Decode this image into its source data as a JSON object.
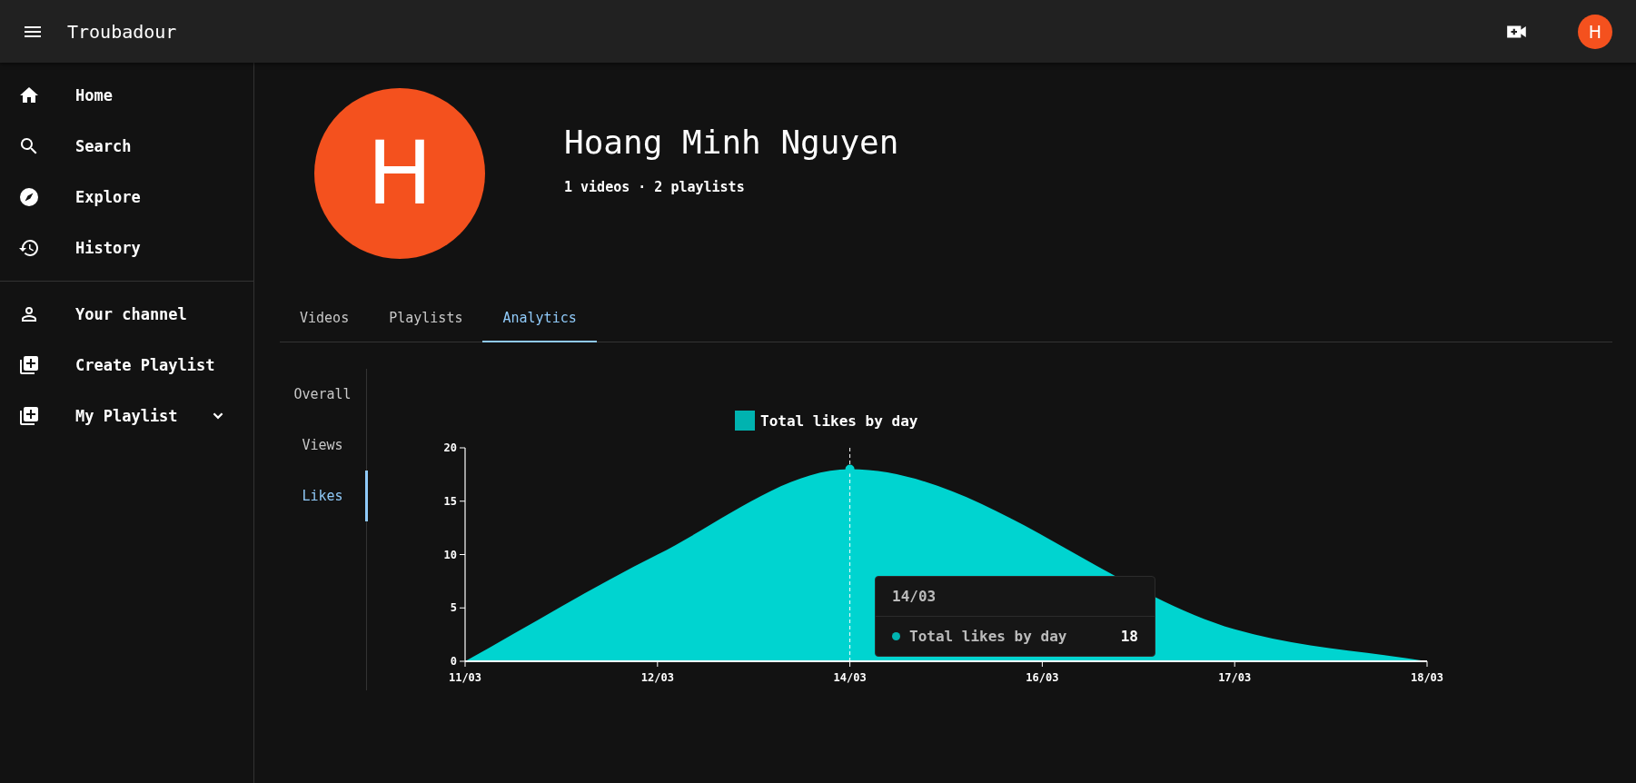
{
  "app_bar": {
    "title": "Troubadour",
    "avatar_letter": "H"
  },
  "sidebar": {
    "items": [
      {
        "label": "Home",
        "selected": false
      },
      {
        "label": "Search",
        "selected": false
      },
      {
        "label": "Explore",
        "selected": false
      },
      {
        "label": "History",
        "selected": false
      }
    ],
    "items_2": [
      {
        "label": "Your channel",
        "kind": "link",
        "selected": false
      },
      {
        "label": "Create Playlist",
        "kind": "link",
        "selected": false
      },
      {
        "label": "My Playlist",
        "kind": "group",
        "expanded": false,
        "selected": false
      }
    ]
  },
  "channel": {
    "avatar_letter": "H",
    "name": "Hoang Minh Nguyen",
    "stats": "1 videos · 2 playlists"
  },
  "tabs": [
    {
      "label": "Videos",
      "selected": false
    },
    {
      "label": "Playlists",
      "selected": false
    },
    {
      "label": "Analytics",
      "selected": true
    }
  ],
  "analytics_tabs": [
    {
      "label": "Overall",
      "selected": false
    },
    {
      "label": "Views",
      "selected": false
    },
    {
      "label": "Likes",
      "selected": true
    }
  ],
  "chart_data": {
    "type": "area",
    "categories": [
      "11/03",
      "12/03",
      "14/03",
      "16/03",
      "17/03",
      "18/03"
    ],
    "series": [
      {
        "name": "Total likes by day",
        "color": "#00d4d0",
        "values": [
          0,
          10,
          18,
          null,
          3,
          0
        ]
      }
    ],
    "ylim": [
      0,
      20
    ],
    "yticks": [
      0,
      5,
      10,
      15,
      20
    ]
  },
  "tooltip": {
    "title": "14/03",
    "label": "Total likes by day",
    "value": "18",
    "color": "#00b3b0"
  }
}
